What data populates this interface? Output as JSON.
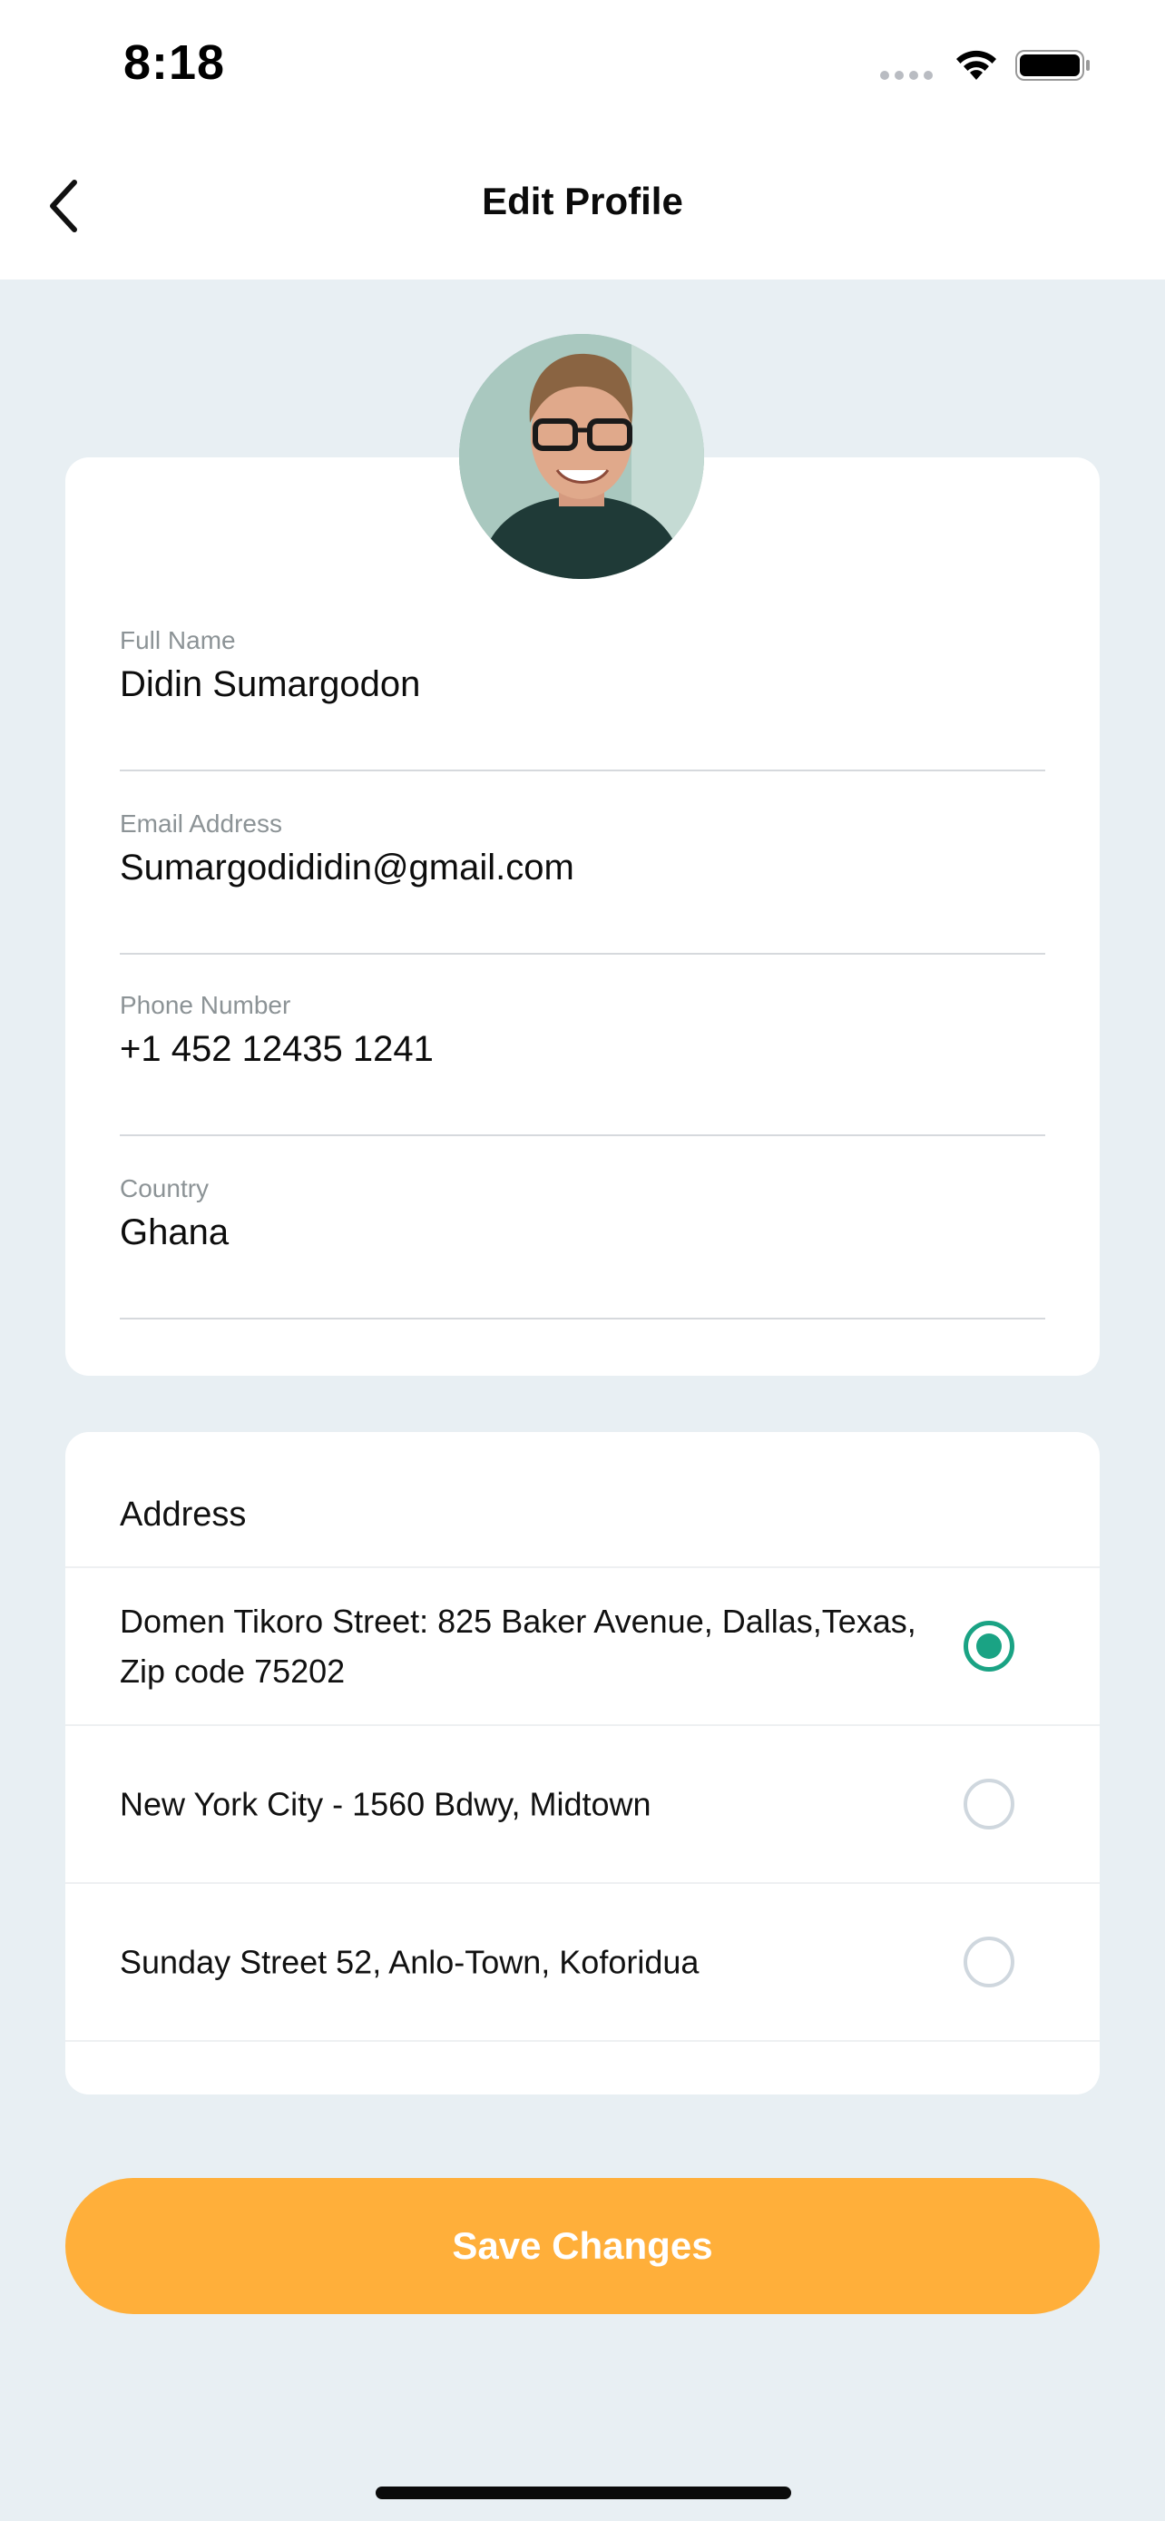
{
  "status_bar": {
    "time": "8:18"
  },
  "nav": {
    "title": "Edit Profile",
    "back_icon": "chevron-left-icon"
  },
  "profile": {
    "avatar_icon": "avatar",
    "fields": [
      {
        "label": "Full Name",
        "value": "Didin Sumargodon"
      },
      {
        "label": "Email Address",
        "value": "Sumargodididin@gmail.com"
      },
      {
        "label": "Phone Number",
        "value": "+1 452 12435 1241"
      },
      {
        "label": "Country",
        "value": "Ghana"
      }
    ]
  },
  "address": {
    "title": "Address",
    "items": [
      {
        "text": "Domen Tikoro Street: 825 Baker Avenue, Dallas,Texas, Zip code 75202",
        "selected": true
      },
      {
        "text": "New York City - 1560 Bdwy, Midtown",
        "selected": false
      },
      {
        "text": "Sunday Street 52, Anlo-Town, Koforidua",
        "selected": false
      }
    ]
  },
  "actions": {
    "save_label": "Save Changes"
  },
  "colors": {
    "accent": "#ffaf3a",
    "radio_selected": "#1aa384",
    "background": "#e8eff3"
  }
}
